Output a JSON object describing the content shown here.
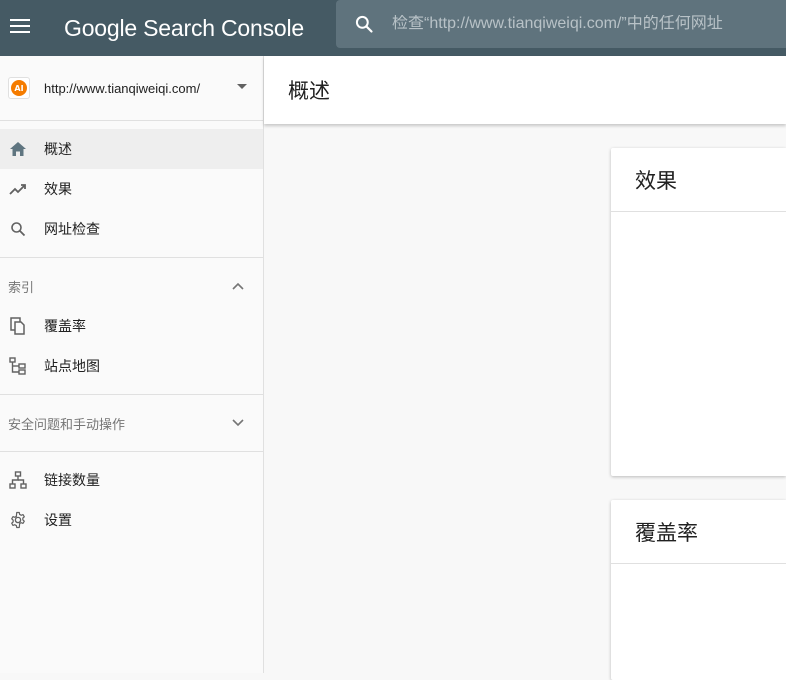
{
  "topbar": {
    "brand": "Google Search Console",
    "search_placeholder": "检查“http://www.tianqiweiqi.com/”中的任何网址"
  },
  "property": {
    "favicon_text": "AI",
    "url": "http://www.tianqiweiqi.com/"
  },
  "nav": {
    "items": [
      {
        "label": "概述",
        "icon": "home-icon",
        "active": true
      },
      {
        "label": "效果",
        "icon": "trending-up-icon"
      },
      {
        "label": "网址检查",
        "icon": "search-icon"
      }
    ],
    "index_section": {
      "label": "索引",
      "expanded": true,
      "items": [
        {
          "label": "覆盖率",
          "icon": "copy-icon"
        },
        {
          "label": "站点地图",
          "icon": "sitemap-icon"
        }
      ]
    },
    "security_section": {
      "label": "安全问题和手动操作",
      "expanded": false
    },
    "bottom_items": [
      {
        "label": "链接数量",
        "icon": "links-icon"
      },
      {
        "label": "设置",
        "icon": "gear-icon"
      }
    ]
  },
  "main": {
    "title": "概述",
    "cards": [
      {
        "title": "效果"
      },
      {
        "title": "覆盖率"
      }
    ]
  },
  "colors": {
    "topbar": "#455a64",
    "search_bg": "#5f737d",
    "active_item": "#eeeeee",
    "favicon": "#f57c00"
  }
}
